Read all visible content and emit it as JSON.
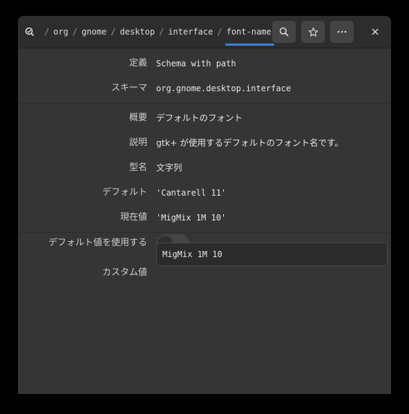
{
  "breadcrumb": {
    "items": [
      "org",
      "gnome",
      "desktop",
      "interface",
      "font-name"
    ],
    "separator": "/"
  },
  "header": {
    "search_icon": "search-icon",
    "bookmark_icon": "star-icon",
    "menu_icon": "more-horizontal-icon",
    "close_icon": "close-icon"
  },
  "fields": {
    "definition": {
      "label": "定義",
      "value": "Schema with path"
    },
    "schema": {
      "label": "スキーマ",
      "value": "org.gnome.desktop.interface"
    },
    "summary": {
      "label": "概要",
      "value": "デフォルトのフォント"
    },
    "description": {
      "label": "説明",
      "value": "gtk+ が使用するデフォルトのフォント名です。"
    },
    "type": {
      "label": "型名",
      "value": "文字列"
    },
    "default": {
      "label": "デフォルト",
      "value": "'Cantarell 11'"
    },
    "current": {
      "label": "現在値",
      "value": "'MigMix 1M 10'"
    }
  },
  "use_default": {
    "label": "デフォルト値を使用する",
    "enabled": false
  },
  "custom": {
    "label": "カスタム値",
    "value": "MigMix 1M 10"
  },
  "colors": {
    "accent": "#3584e4",
    "window_bg": "#353535",
    "header_bg": "#2d2d2d"
  }
}
